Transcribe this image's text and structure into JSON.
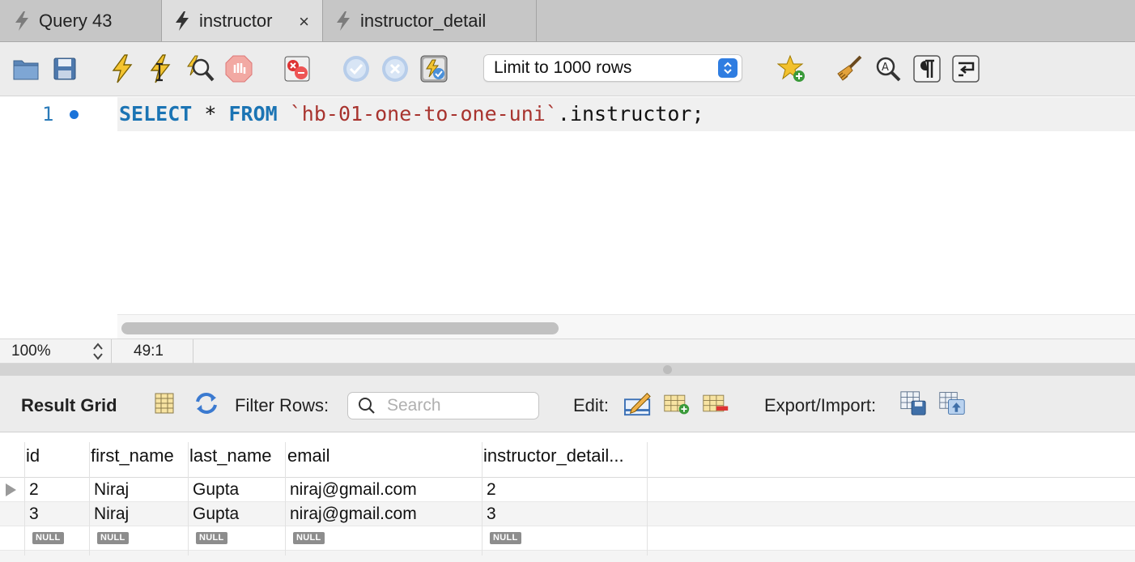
{
  "tabs": [
    {
      "label": "Query 43",
      "active": false
    },
    {
      "label": "instructor",
      "active": true,
      "close": "×"
    },
    {
      "label": "instructor_detail",
      "active": false
    }
  ],
  "toolbar": {
    "icons": [
      "open-folder-icon",
      "save-icon",
      "execute-icon",
      "execute-current-icon",
      "explain-icon",
      "stop-icon",
      "toggle-stop-on-error-icon",
      "commit-icon",
      "rollback-icon",
      "autocommit-icon",
      "add-snippet-icon",
      "beautify-icon",
      "find-icon",
      "invisible-chars-icon",
      "wrap-lines-icon"
    ],
    "limit_select": "Limit to 1000 rows"
  },
  "editor": {
    "line_number": "1",
    "tokens": [
      {
        "text": "SELECT",
        "type": "kw"
      },
      {
        "text": " * ",
        "type": "plain"
      },
      {
        "text": "FROM",
        "type": "kw"
      },
      {
        "text": " ",
        "type": "plain"
      },
      {
        "text": "`hb-01-one-to-one-uni`",
        "type": "str"
      },
      {
        "text": ".instructor;",
        "type": "plain"
      }
    ]
  },
  "status": {
    "zoom": "100%",
    "cursor": "49:1"
  },
  "result_bar": {
    "title": "Result Grid",
    "filter_label": "Filter Rows:",
    "search_placeholder": "Search",
    "edit_label": "Edit:",
    "export_label": "Export/Import:"
  },
  "grid": {
    "columns": [
      "id",
      "first_name",
      "last_name",
      "email",
      "instructor_detail..."
    ],
    "rows": [
      [
        "2",
        "Niraj",
        "Gupta",
        "niraj@gmail.com",
        "2"
      ],
      [
        "3",
        "Niraj",
        "Gupta",
        "niraj@gmail.com",
        "3"
      ]
    ],
    "null_label": "NULL"
  },
  "colors": {
    "keyword": "#1b74b4",
    "string": "#a8332e",
    "accent": "#2f7de1"
  }
}
